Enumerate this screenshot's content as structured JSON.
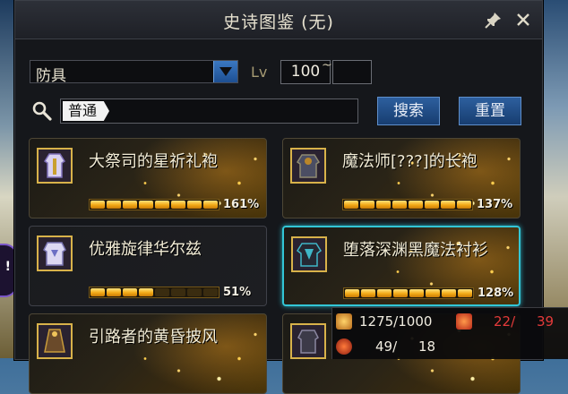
{
  "window": {
    "title": "史诗图鉴 (无)"
  },
  "filters": {
    "category": "防具",
    "level_label": "Lv",
    "level_min": "100",
    "level_sep": "~",
    "level_max": ""
  },
  "search": {
    "tag": "普通",
    "search_button": "搜索",
    "reset_button": "重置"
  },
  "items": [
    {
      "name": "大祭司的星祈礼袍",
      "percent": "161%",
      "progress": 1.0,
      "shine": true,
      "selected": false
    },
    {
      "name": "魔法师[???]的长袍",
      "percent": "137%",
      "progress": 1.0,
      "shine": true,
      "selected": false
    },
    {
      "name": "优雅旋律华尔兹",
      "percent": "51%",
      "progress": 0.51,
      "shine": false,
      "selected": false
    },
    {
      "name": "堕落深渊黑魔法衬衫",
      "percent": "128%",
      "progress": 1.0,
      "shine": true,
      "selected": true
    },
    {
      "name": "引路者的黄昏披风",
      "percent": "",
      "progress": 0,
      "shine": true,
      "selected": false
    }
  ],
  "stats": {
    "fatigue": "1275/1000",
    "count_current": "22/",
    "count_total": "39",
    "bottom_a": "49/",
    "bottom_b": "18"
  },
  "colors": {
    "accent_blue": "#2d5f9e",
    "selected_border": "#33c6d6",
    "progress_gold": "#f2a916",
    "alert_red": "#e43a3a"
  }
}
